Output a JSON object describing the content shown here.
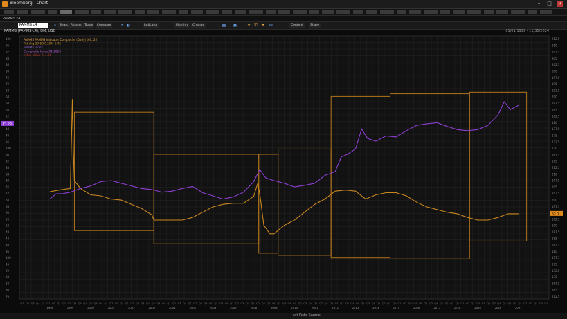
{
  "window": {
    "title": "Bloomberg - Chart"
  },
  "menu_count": 40,
  "ribbon": {
    "label": "PAMMS c4"
  },
  "toolbar": {
    "security": "PAMMS c4",
    "buttons": [
      "Search",
      "Related",
      "Trade",
      "Compare",
      "Indicator",
      "Monthly",
      "Change",
      "Content",
      "Share"
    ]
  },
  "panel": {
    "title": "PAMMS (PAMMS-c4), DM, USD",
    "range": "01/01/1999 - 11/30/2024"
  },
  "legend": [
    {
      "label": "PAMMS PAMMS Indicator Composite (Daily) (01, 22)",
      "color": "#e2a34a"
    },
    {
      "label": "Pct chg 30.89 9.29% 0.45",
      "color": "#c48a2a"
    },
    {
      "label": "PAMMS Index",
      "color": "#8e5bd0"
    },
    {
      "label": "Composite Index 01 2024",
      "color": "#b05bd0"
    },
    {
      "label": "Index Value 214.28",
      "color": "#c0392b"
    }
  ],
  "status": {
    "text": "Last Data Source"
  },
  "colors": {
    "orange": "#c9871f",
    "purple": "#8e3fd4",
    "box": "#b0731c",
    "grid": "#242424"
  },
  "chart_data": {
    "type": "line",
    "series": [
      {
        "name": "PAMMS",
        "color": "#c9871f",
        "values": [
          [
            1998.0,
            56.4
          ],
          [
            1998.3,
            56.6
          ],
          [
            1998.6,
            56.8
          ],
          [
            1999.0,
            57.0
          ],
          [
            1999.1,
            74.0
          ],
          [
            1999.15,
            64.0
          ],
          [
            1999.2,
            58.5
          ],
          [
            1999.5,
            57.0
          ],
          [
            2000.0,
            55.8
          ],
          [
            2000.5,
            55.6
          ],
          [
            2001.0,
            55.0
          ],
          [
            2001.5,
            54.8
          ],
          [
            2002.0,
            54.0
          ],
          [
            2002.5,
            53.2
          ],
          [
            2003.0,
            52.0
          ],
          [
            2003.1,
            51.0
          ],
          [
            2003.5,
            51.0
          ],
          [
            2004.0,
            51.0
          ],
          [
            2004.5,
            51.0
          ],
          [
            2005.0,
            51.5
          ],
          [
            2005.5,
            52.5
          ],
          [
            2006.0,
            53.5
          ],
          [
            2006.5,
            54.0
          ],
          [
            2007.0,
            54.2
          ],
          [
            2007.5,
            54.2
          ],
          [
            2008.0,
            55.5
          ],
          [
            2008.2,
            58.0
          ],
          [
            2008.3,
            56.0
          ],
          [
            2008.5,
            50.0
          ],
          [
            2008.8,
            48.4
          ],
          [
            2009.0,
            48.4
          ],
          [
            2009.5,
            50.0
          ],
          [
            2010.0,
            51.0
          ],
          [
            2010.5,
            52.5
          ],
          [
            2011.0,
            54.0
          ],
          [
            2011.5,
            55.0
          ],
          [
            2012.0,
            56.5
          ],
          [
            2012.5,
            56.7
          ],
          [
            2013.0,
            56.5
          ],
          [
            2013.5,
            55.0
          ],
          [
            2014.0,
            55.8
          ],
          [
            2014.5,
            56.2
          ],
          [
            2015.0,
            56.2
          ],
          [
            2015.5,
            55.6
          ],
          [
            2016.0,
            54.4
          ],
          [
            2016.5,
            53.5
          ],
          [
            2017.0,
            53.0
          ],
          [
            2017.5,
            52.5
          ],
          [
            2018.0,
            52.2
          ],
          [
            2018.5,
            51.5
          ],
          [
            2019.0,
            51.0
          ],
          [
            2019.5,
            51.0
          ],
          [
            2020.0,
            51.5
          ],
          [
            2020.5,
            52.2
          ],
          [
            2021.0,
            52.2
          ]
        ]
      },
      {
        "name": "Index",
        "color": "#8e3fd4",
        "values": [
          [
            1998.0,
            55.0
          ],
          [
            1998.3,
            56.0
          ],
          [
            1998.6,
            56.0
          ],
          [
            1999.0,
            56.3
          ],
          [
            1999.5,
            57.0
          ],
          [
            2000.0,
            57.5
          ],
          [
            2000.5,
            58.3
          ],
          [
            2001.0,
            58.5
          ],
          [
            2001.5,
            58.0
          ],
          [
            2002.0,
            57.5
          ],
          [
            2002.5,
            57.0
          ],
          [
            2003.0,
            56.8
          ],
          [
            2003.5,
            56.3
          ],
          [
            2004.0,
            56.5
          ],
          [
            2004.5,
            57.0
          ],
          [
            2005.0,
            57.4
          ],
          [
            2005.5,
            56.2
          ],
          [
            2006.0,
            55.6
          ],
          [
            2006.5,
            55.0
          ],
          [
            2007.0,
            55.4
          ],
          [
            2007.5,
            56.3
          ],
          [
            2008.0,
            58.3
          ],
          [
            2008.3,
            60.6
          ],
          [
            2008.6,
            59.0
          ],
          [
            2009.0,
            58.5
          ],
          [
            2009.5,
            58.0
          ],
          [
            2010.0,
            57.3
          ],
          [
            2010.5,
            57.6
          ],
          [
            2011.0,
            58.0
          ],
          [
            2011.5,
            59.5
          ],
          [
            2012.0,
            60.2
          ],
          [
            2012.3,
            63.0
          ],
          [
            2012.6,
            63.5
          ],
          [
            2013.0,
            64.5
          ],
          [
            2013.3,
            68.3
          ],
          [
            2013.6,
            66.5
          ],
          [
            2014.0,
            66.0
          ],
          [
            2014.5,
            67.0
          ],
          [
            2015.0,
            66.8
          ],
          [
            2015.5,
            68.0
          ],
          [
            2016.0,
            69.0
          ],
          [
            2016.5,
            69.3
          ],
          [
            2017.0,
            69.5
          ],
          [
            2017.5,
            68.8
          ],
          [
            2018.0,
            68.2
          ],
          [
            2018.5,
            68.0
          ],
          [
            2019.0,
            68.2
          ],
          [
            2019.5,
            69.0
          ],
          [
            2020.0,
            71.0
          ],
          [
            2020.3,
            73.5
          ],
          [
            2020.6,
            72.0
          ],
          [
            2021.0,
            72.8
          ]
        ]
      }
    ],
    "boxes": [
      {
        "x0": 1999.2,
        "x1": 2003.1,
        "y0": 49.0,
        "y1": 71.5
      },
      {
        "x0": 2003.1,
        "x1": 2008.25,
        "y0": 46.5,
        "y1": 63.5
      },
      {
        "x0": 2008.25,
        "x1": 2009.2,
        "y0": 44.7,
        "y1": 63.5
      },
      {
        "x0": 2009.2,
        "x1": 2011.8,
        "y0": 44.3,
        "y1": 64.5
      },
      {
        "x0": 2011.8,
        "x1": 2014.7,
        "y0": 43.8,
        "y1": 74.5
      },
      {
        "x0": 2014.7,
        "x1": 2018.6,
        "y0": 43.6,
        "y1": 75.0
      },
      {
        "x0": 2018.6,
        "x1": 2021.4,
        "y0": 47.0,
        "y1": 75.3
      }
    ],
    "xlim": [
      1996.5,
      2022.5
    ],
    "ylim": [
      36,
      86
    ],
    "left_axis_ticks": [
      100,
      96,
      92,
      88,
      84,
      80,
      76,
      72,
      68,
      64,
      60,
      56,
      52,
      48,
      44,
      40,
      36
    ],
    "right_axis_ticks": [
      "212.5",
      "210",
      "207.5",
      "205",
      "202.5",
      "200",
      "197.5",
      "195",
      "192.5",
      "190",
      "187.5",
      "185",
      "182.5",
      "180",
      "177.5",
      "175",
      "172.5",
      "170",
      "167.5",
      "165"
    ],
    "left_highlight": "71.29",
    "right_highlight": "52.0"
  }
}
